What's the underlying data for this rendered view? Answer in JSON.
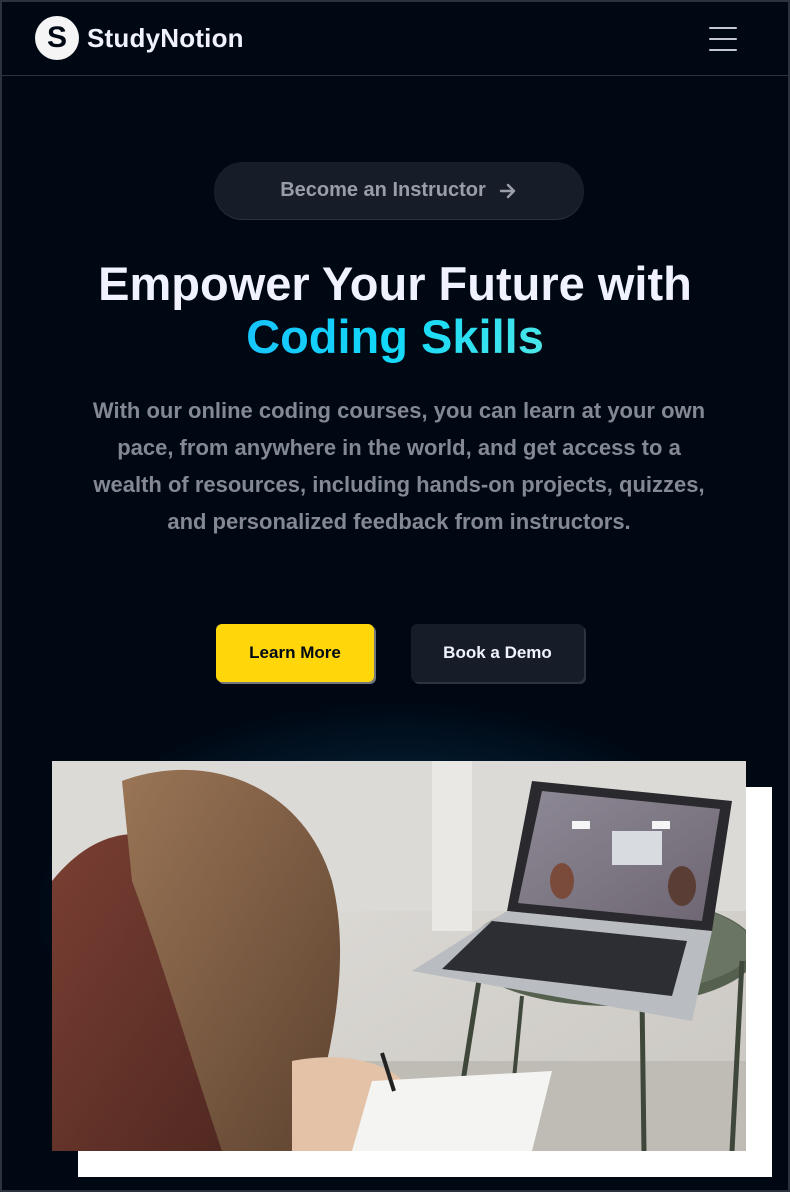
{
  "navbar": {
    "logo_letter": "S",
    "logo_text": "StudyNotion",
    "menu_icon": "hamburger-menu-icon"
  },
  "hero": {
    "instructor_button": "Become an Instructor",
    "instructor_arrow_icon": "arrow-right-icon",
    "headline_line1": "Empower Your Future with",
    "headline_highlight": "Coding Skills",
    "subtext": "With our online coding courses, you can learn at your own pace, from anywhere in the world, and get access to a wealth of resources, including hands-on projects, quizzes, and personalized feedback from instructors.",
    "learn_more": "Learn More",
    "book_demo": "Book a Demo"
  },
  "colors": {
    "background": "#000814",
    "accent_yellow": "#FFD60A",
    "button_dark": "#161D29",
    "text_light": "#F1F2FF",
    "text_muted": "#838894",
    "gradient": [
      "#1FA2FF",
      "#12D8FA",
      "#A6FFCB"
    ]
  }
}
